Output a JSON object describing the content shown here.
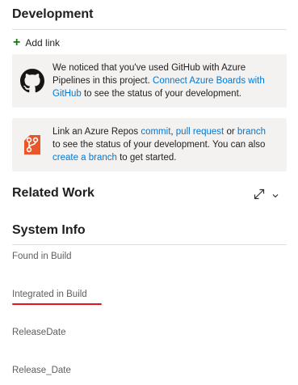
{
  "development": {
    "title": "Development",
    "add_link_label": "Add link",
    "github_box": {
      "icon": "github-icon",
      "text_1": "We noticed that you've used GitHub with Azure Pipelines in this project. ",
      "link_1": "Connect Azure Boards with GitHub",
      "text_2": " to see the status of your development."
    },
    "repos_box": {
      "icon": "azure-repos-icon",
      "text_1": "Link an Azure Repos ",
      "link_commit": "commit",
      "sep_1": ", ",
      "link_pr": "pull request",
      "sep_2": " or ",
      "link_branch": "branch",
      "text_2": " to see the status of your development. You can also ",
      "link_create_branch": "create a branch",
      "text_3": " to get started."
    }
  },
  "related_work": {
    "title": "Related Work",
    "expand_icon": "expand-icon",
    "chevron_icon": "chevron-down-icon"
  },
  "system_info": {
    "title": "System Info",
    "fields": [
      {
        "label": "Found in Build"
      },
      {
        "label": "Integrated in Build"
      },
      {
        "label": "ReleaseDate"
      },
      {
        "label": "Release_Date"
      }
    ]
  },
  "colors": {
    "link": "#0078d4",
    "add_plus": "#107c10",
    "repos_brand": "#e8562a",
    "annotation_underline": "#e81123"
  }
}
